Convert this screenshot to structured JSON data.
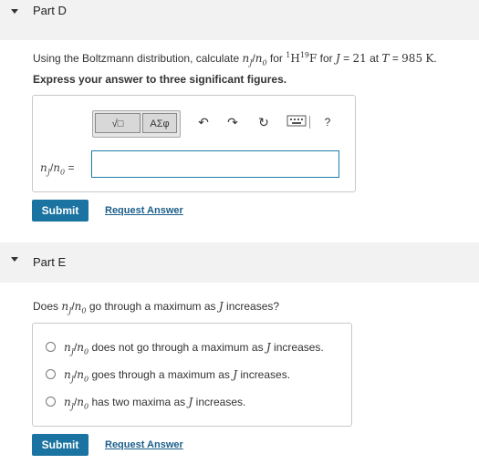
{
  "part_d": {
    "title": "Part D",
    "question": {
      "pre": "Using the Boltzmann distribution, calculate ",
      "mid": " for ",
      "j_val": "21",
      "t_val": "985",
      "unit": "K"
    },
    "instruction": "Express your answer to three significant figures.",
    "toolbar": {
      "templates_label": "√□",
      "symbols_label": "ΑΣφ",
      "help_label": "?"
    },
    "input_label_suffix": "=",
    "input_value": "",
    "submit_label": "Submit",
    "request_answer_label": "Request Answer"
  },
  "part_e": {
    "title": "Part E",
    "question_pre": "Does ",
    "question_mid": " go through a maximum as ",
    "question_post": " increases?",
    "choices": [
      {
        "text_pre": "",
        "text_mid": " does not go through a maximum as ",
        "text_post": " increases."
      },
      {
        "text_pre": "",
        "text_mid": " goes through a maximum as ",
        "text_post": " increases."
      },
      {
        "text_pre": "",
        "text_mid": " has two maxima as ",
        "text_post": " increases."
      }
    ],
    "submit_label": "Submit",
    "request_answer_label": "Request Answer"
  }
}
